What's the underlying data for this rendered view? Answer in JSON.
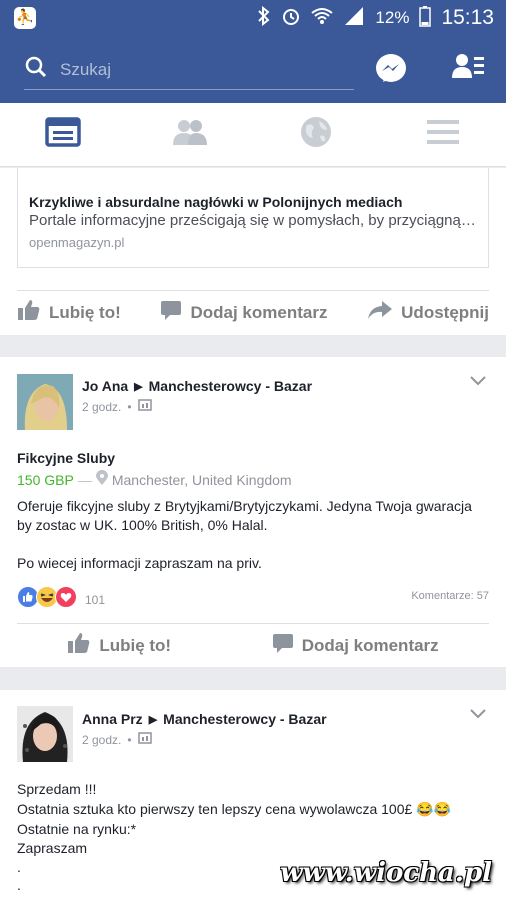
{
  "statusbar": {
    "battery": "12%",
    "time": "15:13"
  },
  "search": {
    "placeholder": "Szukaj"
  },
  "link_post": {
    "title": "Krzykliwe i absurdalne nagłówki w Polonijnych mediach",
    "description": "Portale informacyjne prześcigają się w pomysłach, by przyciągnąć jak…",
    "domain": "openmagazyn.pl",
    "like_label": "Lubię to!",
    "comment_label": "Dodaj komentarz",
    "share_label": "Udostępnij"
  },
  "post1": {
    "author": "Jo Ana",
    "group": "Manchesterowcy - Bazar",
    "time": "2 godz.",
    "item_title": "Fikcyjne Sluby",
    "price": "150 GBP",
    "price_sep": "—",
    "location": "Manchester, United Kingdom",
    "body_line1": "Oferuje fikcyjne sluby z Brytyjkami/Brytyjczykami. Jedyna Twoja gwaracja",
    "body_line2": "by zostac w UK. 100% British, 0% Halal.",
    "body_line3": "Po wiecej informacji zapraszam na priv.",
    "reactions_count": "101",
    "comments": "Komentarze: 57",
    "like_label": "Lubię to!",
    "comment_label": "Dodaj komentarz"
  },
  "post2": {
    "author": "Anna Prz",
    "group": "Manchesterowcy - Bazar",
    "time": "2 godz.",
    "line1": "Sprzedam !!!",
    "line2": "Ostatnia sztuka kto pierwszy ten lepszy cena wywolawcza 100£ 😂😂",
    "line3": "Ostatnie na rynku:*",
    "line4": "Zapraszam",
    "line5": ".",
    "line6": "."
  },
  "watermark": "www.wiocha.pl",
  "colors": {
    "brand": "#3b5998",
    "price": "#42b72a"
  }
}
